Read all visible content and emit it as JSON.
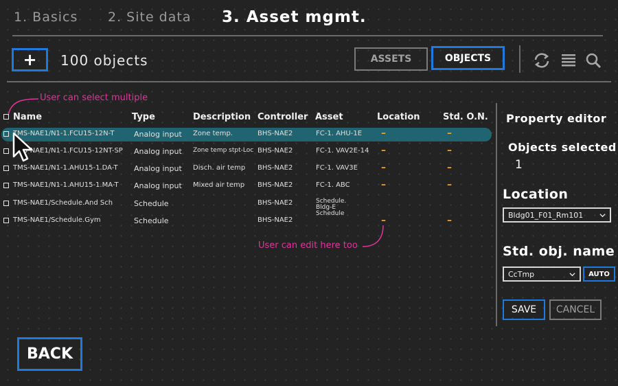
{
  "steps": [
    {
      "label": "1. Basics"
    },
    {
      "label": "2. Site data"
    },
    {
      "label": "3. Asset mgmt."
    }
  ],
  "toolbar": {
    "add_label": "+",
    "count_label": "100 objects",
    "assets_label": "ASSETS",
    "objects_label": "OBJECTS",
    "active_view": "objects",
    "icons": [
      "refresh-icon",
      "list-icon",
      "search-icon"
    ]
  },
  "annotations": {
    "select_multiple": "User can select multiple",
    "edit_here": "User can edit here too"
  },
  "table": {
    "columns": [
      "Name",
      "Type",
      "Description",
      "Controller",
      "Asset",
      "Location",
      "Std. O.N."
    ],
    "rows": [
      {
        "name": "TMS-NAE1/N1-1.FCU15-12N-T",
        "type": "Analog input",
        "description": "Zone temp.",
        "controller": "BHS-NAE2",
        "asset": "FC-1. AHU-1E",
        "location": "–",
        "std_on": "–",
        "selected": true
      },
      {
        "name": "TMS-NAE1/N1-1.FCU15-12NT-SP",
        "type": "Analog input",
        "description": "Zone temp stpt-Loc",
        "controller": "BHS-NAE2",
        "asset": "FC-1. VAV2E-14",
        "location": "–",
        "std_on": "–",
        "selected": false
      },
      {
        "name": "TMS-NAE1/N1-1.AHU15-1.DA-T",
        "type": "Analog input",
        "description": "Disch. air temp",
        "controller": "BHS-NAE2",
        "asset": "FC-1. VAV3E",
        "location": "–",
        "std_on": "–",
        "selected": false
      },
      {
        "name": "TMS-NAE1/N1-1.AHU15-1.MA-T",
        "type": "Analog input",
        "description": "Mixed air temp",
        "controller": "BHS-NAE2",
        "asset": "FC-1. ABC",
        "location": "–",
        "std_on": "–",
        "selected": false
      },
      {
        "name": "TMS-NAE1/Schedule.And Sch",
        "type": "Schedule",
        "description": "",
        "controller": "BHS-NAE2",
        "asset": "Schedule. Bldg-E Schedule",
        "location": "",
        "std_on": "",
        "selected": false
      },
      {
        "name": "TMS-NAE1/Schedule.Gym",
        "type": "Schedule",
        "description": "",
        "controller": "BHS-NAE2",
        "asset": "",
        "location": "–",
        "std_on": "–",
        "selected": false
      }
    ]
  },
  "property_editor": {
    "title": "Property editor",
    "objects_selected_label": "Objects selected",
    "objects_selected_count": "1",
    "location_label": "Location",
    "location_value": "Bldg01_F01_Rm101",
    "std_name_label": "Std. obj. name",
    "std_name_value": "CcTmp",
    "auto_label": "AUTO",
    "save_label": "SAVE",
    "cancel_label": "CANCEL"
  },
  "back_label": "BACK",
  "colors": {
    "accent": "#1f7ae0",
    "selected_row": "#1f6470",
    "annotation": "#e0349a",
    "dash": "#f0a020",
    "background": "#232323"
  }
}
